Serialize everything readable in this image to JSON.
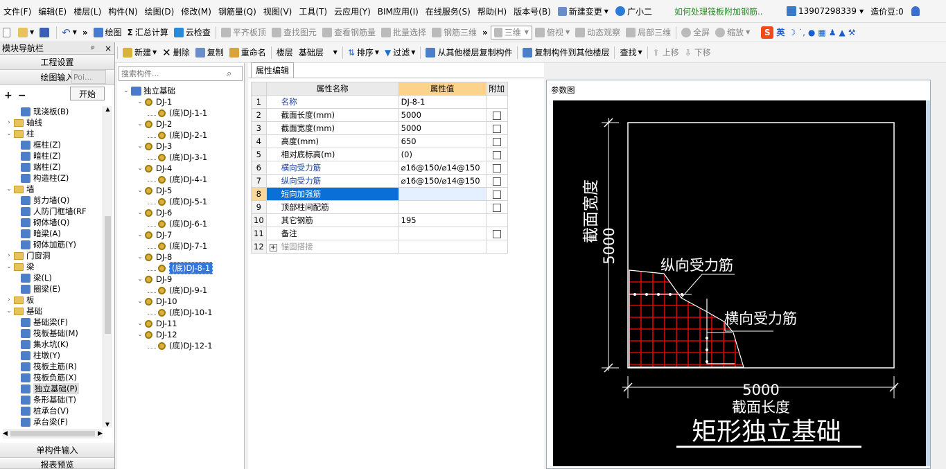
{
  "menu": {
    "items": [
      "文件(F)",
      "编辑(E)",
      "楼层(L)",
      "构件(N)",
      "绘图(D)",
      "修改(M)",
      "钢筋量(Q)",
      "视图(V)",
      "工具(T)",
      "云应用(Y)",
      "BIM应用(I)",
      "在线服务(S)",
      "帮助(H)",
      "版本号(B)"
    ],
    "new_change": "新建变更",
    "guangxiaoer": "广小二",
    "hint_link": "如何处理筏板附加钢筋..",
    "phone": "13907298339",
    "price_label": "造价豆:0"
  },
  "toolbar1": {
    "draw": "绘图",
    "sum_calc": "汇总计算",
    "cloud_check": "云检查",
    "flatten_top": "平齐板顶",
    "find_element": "查找图元",
    "view_rebar": "查看钢筋量",
    "batch_select": "批量选择",
    "rebar_3d": "钢筋三维",
    "view_3d": "三维",
    "top_view": "俯视",
    "dynamic_observe": "动态观察",
    "local_3d": "局部三维",
    "fullscreen": "全屏",
    "zoom": "缩放",
    "ime_lang": "英"
  },
  "toolbar2": {
    "new": "新建",
    "delete": "删除",
    "copy": "复制",
    "rename": "重命名",
    "floor_label": "楼层",
    "floor_value": "基础层",
    "sort": "排序",
    "filter": "过滤",
    "copy_from_other": "从其他楼层复制构件",
    "copy_to_other": "复制构件到其他楼层",
    "find": "查找",
    "move_up": "上移",
    "move_down": "下移"
  },
  "nav": {
    "title": "模块导航栏",
    "pin": "ᵖ",
    "close": "×",
    "project_settings": "工程设置",
    "draw_input": "绘图输入",
    "popup_text": "Poi...",
    "start_button": "开始",
    "single_input": "单构件输入",
    "report_preview": "报表预览",
    "tree": [
      {
        "label": "现浇板(B)",
        "level": 2,
        "kind": "item"
      },
      {
        "label": "轴线",
        "level": 1,
        "kind": "folder",
        "exp": "+"
      },
      {
        "label": "柱",
        "level": 1,
        "kind": "folder",
        "exp": "-"
      },
      {
        "label": "框柱(Z)",
        "level": 2,
        "kind": "item"
      },
      {
        "label": "暗柱(Z)",
        "level": 2,
        "kind": "item"
      },
      {
        "label": "端柱(Z)",
        "level": 2,
        "kind": "item"
      },
      {
        "label": "构造柱(Z)",
        "level": 2,
        "kind": "item"
      },
      {
        "label": "墙",
        "level": 1,
        "kind": "folder",
        "exp": "-"
      },
      {
        "label": "剪力墙(Q)",
        "level": 2,
        "kind": "item"
      },
      {
        "label": "人防门框墙(RF",
        "level": 2,
        "kind": "item"
      },
      {
        "label": "砌体墙(Q)",
        "level": 2,
        "kind": "item"
      },
      {
        "label": "暗梁(A)",
        "level": 2,
        "kind": "item"
      },
      {
        "label": "砌体加筋(Y)",
        "level": 2,
        "kind": "item"
      },
      {
        "label": "门窗洞",
        "level": 1,
        "kind": "folder",
        "exp": "+"
      },
      {
        "label": "梁",
        "level": 1,
        "kind": "folder",
        "exp": "-"
      },
      {
        "label": "梁(L)",
        "level": 2,
        "kind": "item"
      },
      {
        "label": "圈梁(E)",
        "level": 2,
        "kind": "item"
      },
      {
        "label": "板",
        "level": 1,
        "kind": "folder",
        "exp": "+"
      },
      {
        "label": "基础",
        "level": 1,
        "kind": "folder",
        "exp": "-"
      },
      {
        "label": "基础梁(F)",
        "level": 2,
        "kind": "item"
      },
      {
        "label": "筏板基础(M)",
        "level": 2,
        "kind": "item"
      },
      {
        "label": "集水坑(K)",
        "level": 2,
        "kind": "item"
      },
      {
        "label": "柱墩(Y)",
        "level": 2,
        "kind": "item"
      },
      {
        "label": "筏板主筋(R)",
        "level": 2,
        "kind": "item"
      },
      {
        "label": "筏板负筋(X)",
        "level": 2,
        "kind": "item"
      },
      {
        "label": "独立基础(P)",
        "level": 2,
        "kind": "item",
        "selected": true
      },
      {
        "label": "条形基础(T)",
        "level": 2,
        "kind": "item"
      },
      {
        "label": "桩承台(V)",
        "level": 2,
        "kind": "item"
      },
      {
        "label": "承台梁(F)",
        "level": 2,
        "kind": "item"
      }
    ]
  },
  "component_tree": {
    "search_placeholder": "搜索构件...",
    "root": "独立基础",
    "items": [
      {
        "label": "DJ-1",
        "level": 1
      },
      {
        "label": "(底)DJ-1-1",
        "level": 2
      },
      {
        "label": "DJ-2",
        "level": 1
      },
      {
        "label": "(底)DJ-2-1",
        "level": 2
      },
      {
        "label": "DJ-3",
        "level": 1
      },
      {
        "label": "(底)DJ-3-1",
        "level": 2
      },
      {
        "label": "DJ-4",
        "level": 1
      },
      {
        "label": "(底)DJ-4-1",
        "level": 2
      },
      {
        "label": "DJ-5",
        "level": 1
      },
      {
        "label": "(底)DJ-5-1",
        "level": 2
      },
      {
        "label": "DJ-6",
        "level": 1
      },
      {
        "label": "(底)DJ-6-1",
        "level": 2
      },
      {
        "label": "DJ-7",
        "level": 1
      },
      {
        "label": "(底)DJ-7-1",
        "level": 2
      },
      {
        "label": "DJ-8",
        "level": 1
      },
      {
        "label": "(底)DJ-8-1",
        "level": 2,
        "selected": true
      },
      {
        "label": "DJ-9",
        "level": 1
      },
      {
        "label": "(底)DJ-9-1",
        "level": 2
      },
      {
        "label": "DJ-10",
        "level": 1
      },
      {
        "label": "(底)DJ-10-1",
        "level": 2
      },
      {
        "label": "DJ-11",
        "level": 1
      },
      {
        "label": "DJ-12",
        "level": 1
      },
      {
        "label": "(底)DJ-12-1",
        "level": 2
      }
    ]
  },
  "properties": {
    "tab": "属性编辑",
    "col_name": "属性名称",
    "col_value": "属性值",
    "col_extra": "附加",
    "rows": [
      {
        "no": "1",
        "name": "名称",
        "value": "DJ-8-1",
        "blue": true,
        "check": false
      },
      {
        "no": "2",
        "name": "截面长度(mm)",
        "value": "5000",
        "blue": false,
        "check": true
      },
      {
        "no": "3",
        "name": "截面宽度(mm)",
        "value": "5000",
        "blue": false,
        "check": true
      },
      {
        "no": "4",
        "name": "高度(mm)",
        "value": "650",
        "blue": false,
        "check": true
      },
      {
        "no": "5",
        "name": "相对底标高(m)",
        "value": "(0)",
        "blue": false,
        "check": true
      },
      {
        "no": "6",
        "name": "横向受力筋",
        "value": "⌀16@150/⌀14@150",
        "blue": true,
        "check": true
      },
      {
        "no": "7",
        "name": "纵向受力筋",
        "value": "⌀16@150/⌀14@150",
        "blue": true,
        "check": true
      },
      {
        "no": "8",
        "name": "短向加强筋",
        "value": "",
        "blue": true,
        "check": true,
        "selected": true
      },
      {
        "no": "9",
        "name": "顶部柱间配筋",
        "value": "",
        "blue": false,
        "check": true
      },
      {
        "no": "10",
        "name": "其它钢筋",
        "value": "195",
        "blue": false,
        "check": false
      },
      {
        "no": "11",
        "name": "备注",
        "value": "",
        "blue": false,
        "check": true
      },
      {
        "no": "12",
        "name": "锚固搭接",
        "value": "",
        "blue": false,
        "check": false,
        "group": true
      }
    ]
  },
  "param_diagram": {
    "title": "参数图",
    "width_label": "截面宽度",
    "width_value": "5000",
    "long_rebar": "纵向受力筋",
    "trans_rebar": "横向受力筋",
    "length_value": "5000",
    "length_label": "截面长度",
    "caption": "矩形独立基础",
    "colors": {
      "bg": "#000000",
      "line": "#ffffff",
      "rebar": "#e00000"
    }
  }
}
